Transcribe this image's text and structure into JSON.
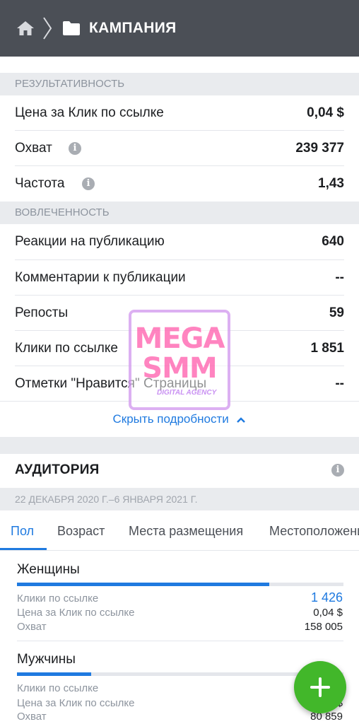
{
  "header": {
    "title": "КАМПАНИЯ",
    "home_icon": "home-icon",
    "folder_icon": "folder-icon"
  },
  "performance": {
    "title": "РЕЗУЛЬТАТИВНОСТЬ",
    "rows": [
      {
        "label": "Цена за Клик по ссылке",
        "value": "0,04 $"
      },
      {
        "label": "Охват",
        "value": "239 377"
      },
      {
        "label": "Частота",
        "value": "1,43"
      }
    ]
  },
  "engagement": {
    "title": "ВОВЛЕЧЕННОСТЬ",
    "rows": [
      {
        "label": "Реакции на публикацию",
        "value": "640"
      },
      {
        "label": "Комментарии к публикации",
        "value": "--"
      },
      {
        "label": "Репосты",
        "value": "59"
      },
      {
        "label": "Клики по ссылке",
        "value": "1 851"
      },
      {
        "label": "Отметки \"Нравится\" Страницы",
        "value": "--"
      }
    ]
  },
  "hide_details": "Скрыть подробности",
  "audience": {
    "title": "АУДИТОРИЯ",
    "date_range": "22 ДЕКАБРЯ 2020 Г.–6 ЯНВАРЯ 2021 Г.",
    "tabs": [
      "Пол",
      "Возраст",
      "Места размещения",
      "Местоположение"
    ],
    "groups": [
      {
        "name": "Женщины",
        "share": 0.772,
        "stats": [
          {
            "label": "Клики по ссылке",
            "value": "1 426"
          },
          {
            "label": "Цена за Клик по ссылке",
            "value": "0,04 $"
          },
          {
            "label": "Охват",
            "value": "158 005"
          }
        ]
      },
      {
        "name": "Мужчины",
        "share": 0.228,
        "stats": [
          {
            "label": "Клики по ссылке",
            "value": ""
          },
          {
            "label": "Цена за Клик по ссылке",
            "value": "$"
          },
          {
            "label": "Охват",
            "value": "80 859"
          }
        ]
      }
    ]
  },
  "watermark": {
    "line1": "MEGA",
    "line2": "SMM",
    "line3": "DIGITAL AGENCY"
  },
  "colors": {
    "accent": "#1f7ae0",
    "fab": "#42b72a",
    "topbar": "#4b4f56"
  }
}
